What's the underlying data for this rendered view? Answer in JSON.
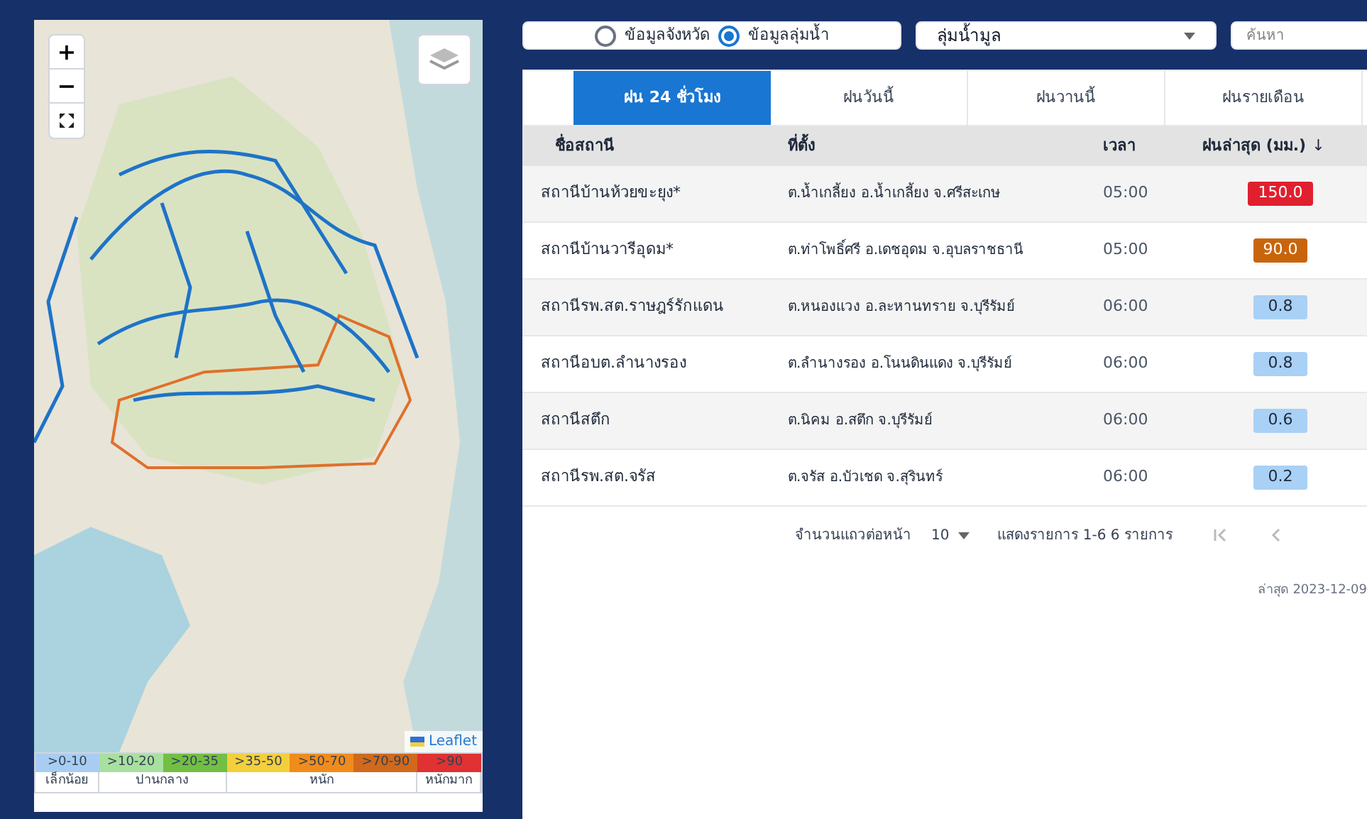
{
  "map": {
    "zoom_in": "+",
    "zoom_out": "−",
    "attribution": "Leaflet",
    "legend": {
      "ranges": [
        {
          "label": ">0-10",
          "color": "#a9cdf2"
        },
        {
          "label": ">10-20",
          "color": "#a8e0a0"
        },
        {
          "label": ">20-35",
          "color": "#72bf44"
        },
        {
          "label": ">35-50",
          "color": "#f3cf3c"
        },
        {
          "label": ">50-70",
          "color": "#f08c1c"
        },
        {
          "label": ">70-90",
          "color": "#d0691c"
        },
        {
          "label": ">90",
          "color": "#e03232"
        }
      ],
      "levels": [
        {
          "label": "เล็กน้อย"
        },
        {
          "label": "ปานกลาง"
        },
        {
          "label": "หนัก"
        },
        {
          "label": "หนักมาก"
        }
      ]
    }
  },
  "source": {
    "options": [
      {
        "label": "ข้อมูลจังหวัด",
        "selected": false
      },
      {
        "label": "ข้อมูลลุ่มน้ำ",
        "selected": true
      }
    ],
    "basin": "ลุ่มน้ำมูล",
    "search": {
      "placeholder": "ค้นหา"
    }
  },
  "tabs": [
    {
      "label": "ฝน 24 ชั่วโมง",
      "selected": true
    },
    {
      "label": "ฝนวันนี้",
      "selected": false
    },
    {
      "label": "ฝนวานนี้",
      "selected": false
    },
    {
      "label": "ฝนรายเดือน",
      "selected": false
    }
  ],
  "table": {
    "columns": [
      "ชื่อสถานี",
      "ที่ตั้ง",
      "เวลา",
      "ฝนล่าสุด (มม.)"
    ],
    "sort_icon": "↓",
    "rows": [
      {
        "station": "สถานีบ้านห้วยขะยุง*",
        "location": "ต.น้ำเกลี้ยง อ.น้ำเกลี้ยง จ.ศรีสะเกษ",
        "time": "05:00",
        "rain": "150.0",
        "color": "#e0202e"
      },
      {
        "station": "สถานีบ้านวารีอุดม*",
        "location": "ต.ท่าโพธิ์ศรี อ.เดชอุดม จ.อุบลราชธานี",
        "time": "05:00",
        "rain": "90.0",
        "color": "#c8650c"
      },
      {
        "station": "สถานีรพ.สต.ราษฎร์รักแดน",
        "location": "ต.หนองแวง อ.ละหานทราย จ.บุรีรัมย์",
        "time": "06:00",
        "rain": "0.8",
        "color": "#a9d0f5"
      },
      {
        "station": "สถานีอบต.ลำนางรอง",
        "location": "ต.ลำนางรอง อ.โนนดินแดง จ.บุรีรัมย์",
        "time": "06:00",
        "rain": "0.8",
        "color": "#a9d0f5"
      },
      {
        "station": "สถานีสตึก",
        "location": "ต.นิคม อ.สตึก จ.บุรีรัมย์",
        "time": "06:00",
        "rain": "0.6",
        "color": "#a9d0f5"
      },
      {
        "station": "สถานีรพ.สต.จรัส",
        "location": "ต.จรัส อ.บัวเชด จ.สุรินทร์",
        "time": "06:00",
        "rain": "0.2",
        "color": "#a9d0f5"
      }
    ]
  },
  "pagination": {
    "rows_label": "จำนวนแถวต่อหน้า",
    "rows_value": "10",
    "range": "แสดงรายการ 1-6 6 รายการ"
  },
  "updated": "ล่าสุด 2023-12-09"
}
